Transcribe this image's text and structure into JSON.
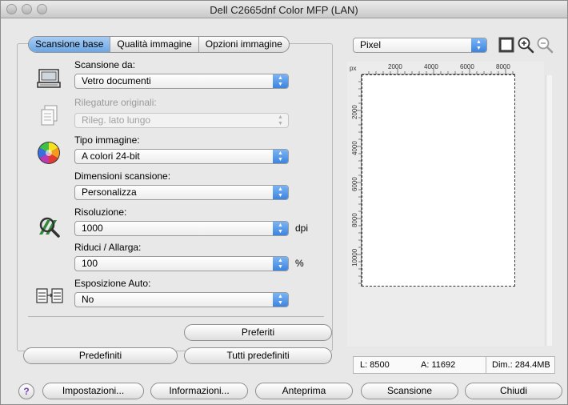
{
  "window": {
    "title": "Dell C2665dnf Color MFP (LAN)"
  },
  "tabs": [
    {
      "label": "Scansione base",
      "active": true
    },
    {
      "label": "Qualità immagine",
      "active": false
    },
    {
      "label": "Opzioni immagine",
      "active": false
    }
  ],
  "fields": {
    "scan_from": {
      "label": "Scansione da:",
      "value": "Vetro documenti"
    },
    "original_binding": {
      "label": "Rilegature originali:",
      "value": "Rileg. lato lungo",
      "disabled": true
    },
    "image_type": {
      "label": "Tipo immagine:",
      "value": "A colori 24-bit"
    },
    "scan_size": {
      "label": "Dimensioni scansione:",
      "value": "Personalizza"
    },
    "resolution": {
      "label": "Risoluzione:",
      "value": "1000",
      "unit": "dpi"
    },
    "reduce_enlarge": {
      "label": "Riduci / Allarga:",
      "value": "100",
      "unit": "%"
    },
    "auto_exposure": {
      "label": "Esposizione Auto:",
      "value": "No"
    }
  },
  "panel_buttons": {
    "favorites": "Preferiti",
    "defaults": "Predefiniti",
    "all_defaults": "Tutti predefiniti"
  },
  "preview": {
    "unit_select": "Pixel",
    "ruler_unit": "px",
    "ruler_x_ticks": [
      "2000",
      "4000",
      "6000",
      "8000"
    ],
    "ruler_y_ticks": [
      "2000",
      "4000",
      "6000",
      "8000",
      "10000"
    ],
    "status": {
      "width": "L:  8500",
      "height": "A:  11692",
      "size": "Dim.:  284.4MB"
    }
  },
  "bottom_buttons": {
    "help": "?",
    "settings": "Impostazioni...",
    "info": "Informazioni...",
    "preview": "Anteprima",
    "scan": "Scansione",
    "close": "Chiudi"
  }
}
